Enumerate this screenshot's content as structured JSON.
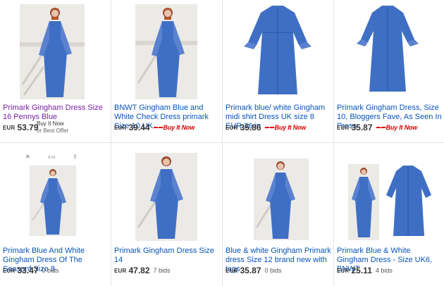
{
  "listings": [
    {
      "title": "Primark Gingham Dress Size 16 Pennys Blue",
      "currency": "EUR",
      "price": "53.79",
      "format": "bin_offer",
      "bin_text": "Buy It Now",
      "offer_text": "or Best Offer",
      "visited": true
    },
    {
      "title": "BNWT Gingham Blue and White Check Dress primark Size 10 UK",
      "currency": "EUR",
      "price": "39.44",
      "format": "bin",
      "bin_text": "Buy It Now"
    },
    {
      "title": "Primark blue/ white Gingham midi shirt Dress UK size 8 EUR 36 in",
      "currency": "EUR",
      "price": "35.86",
      "format": "bin",
      "bin_text": "Buy It Now"
    },
    {
      "title": "Primark Gingham Dress, Size 10, Bloggers Fave, As Seen In Press",
      "currency": "EUR",
      "price": "35.87",
      "format": "bin",
      "bin_text": "Buy It Now"
    },
    {
      "title": "Primark Blue And White Gingham Dress Of The Seasonf Size 8",
      "currency": "EUR",
      "price": "33.47",
      "format": "bids",
      "bids_text": "0 bids"
    },
    {
      "title": "Primark Gingham Dress Size 14",
      "currency": "EUR",
      "price": "47.82",
      "format": "bids",
      "bids_text": "7 bids"
    },
    {
      "title": "Blue & white Gingham Primark dress Size 12 brand new with tags",
      "currency": "EUR",
      "price": "35.87",
      "format": "bids",
      "bids_text": "0 bids"
    },
    {
      "title": "Primark Blue & White Gingham Dress - Size UK6, BNWT",
      "currency": "EUR",
      "price": "25.11",
      "format": "bids",
      "bids_text": "4 bids"
    }
  ],
  "thumb_ui": {
    "close_glyph": "✕",
    "center_text": "9:41",
    "menu_glyph": "⠿"
  },
  "colors": {
    "link": "#0654ba",
    "visited": "#7a1fa2",
    "bin_red": "#d50000",
    "gingham": "#3f6fc4"
  }
}
